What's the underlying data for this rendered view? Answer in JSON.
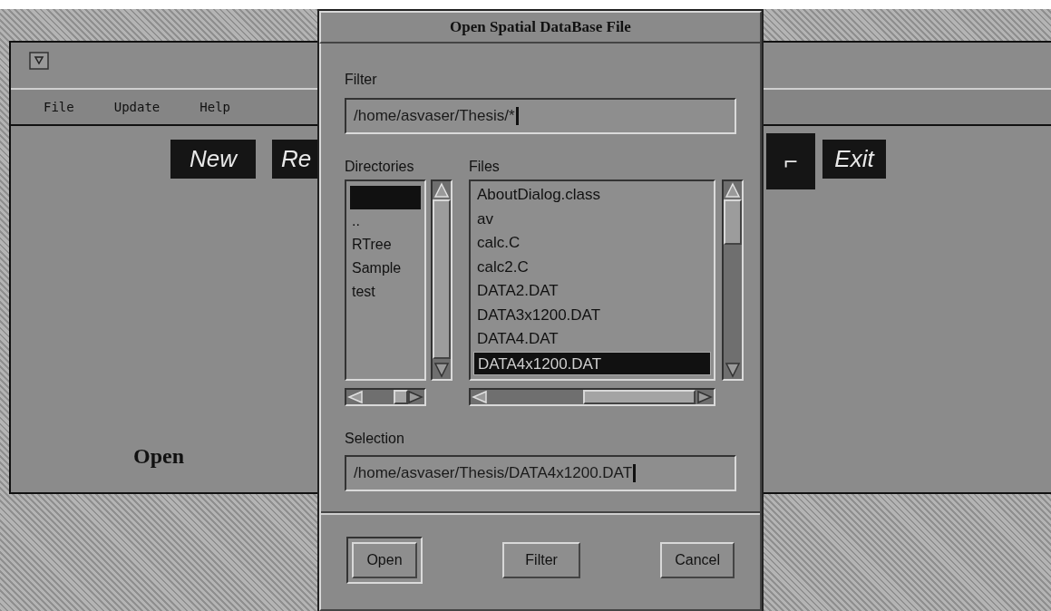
{
  "main_window": {
    "menu": [
      "File",
      "Update",
      "Help"
    ],
    "toolbar": [
      {
        "label": "New"
      },
      {
        "label": "Re"
      },
      {
        "label": "⌐"
      },
      {
        "label": "Exit"
      }
    ],
    "label": "Open"
  },
  "dialog": {
    "title": "Open Spatial DataBase File",
    "filter": {
      "label": "Filter",
      "value": "/home/asvaser/Thesis/*"
    },
    "directories": {
      "label": "Directories",
      "items": [
        {
          "selected": true
        },
        {
          "label": "..",
          "selected": false
        },
        {
          "label": "RTree",
          "selected": false
        },
        {
          "label": "Sample",
          "selected": false
        },
        {
          "label": "test",
          "selected": false
        }
      ]
    },
    "files": {
      "label": "Files",
      "items": [
        {
          "label": "AboutDialog.class",
          "selected": false
        },
        {
          "label": "av",
          "selected": false
        },
        {
          "label": "calc.C",
          "selected": false
        },
        {
          "label": "calc2.C",
          "selected": false
        },
        {
          "label": "DATA2.DAT",
          "selected": false
        },
        {
          "label": "DATA3x1200.DAT",
          "selected": false
        },
        {
          "label": "DATA4.DAT",
          "selected": false
        },
        {
          "label": "DATA4x1200.DAT",
          "selected": true
        }
      ]
    },
    "selection": {
      "label": "Selection",
      "value": "/home/asvaser/Thesis/DATA4x1200.DAT"
    },
    "buttons": [
      {
        "label": "Open",
        "default": true
      },
      {
        "label": "Filter",
        "default": false
      },
      {
        "label": "Cancel",
        "default": false
      }
    ]
  }
}
